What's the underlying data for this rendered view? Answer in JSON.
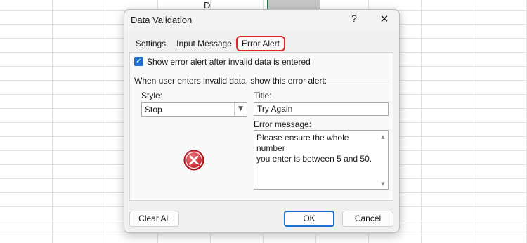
{
  "sheet": {
    "column_header": "D"
  },
  "dialog": {
    "title": "Data Validation",
    "help_label": "?",
    "close_label": "✕",
    "tabs": [
      {
        "label": "Settings"
      },
      {
        "label": "Input Message"
      },
      {
        "label": "Error Alert",
        "selected": true
      }
    ],
    "show_alert": {
      "label": "Show error alert after invalid data is entered",
      "checked": true
    },
    "section_label": "When user enters invalid data, show this error alert:",
    "style": {
      "label": "Style:",
      "value": "Stop"
    },
    "title_field": {
      "label": "Title:",
      "value": "Try Again"
    },
    "error_message": {
      "label": "Error message:",
      "value": "Please ensure the whole number\nyou enter is between 5 and 50."
    },
    "icon": "error-stop-icon",
    "buttons": {
      "clear_all": "Clear All",
      "ok": "OK",
      "cancel": "Cancel"
    },
    "colors": {
      "accent": "#1f6fd1",
      "highlight": "#e0262b",
      "error_icon": "#d9232e"
    }
  }
}
